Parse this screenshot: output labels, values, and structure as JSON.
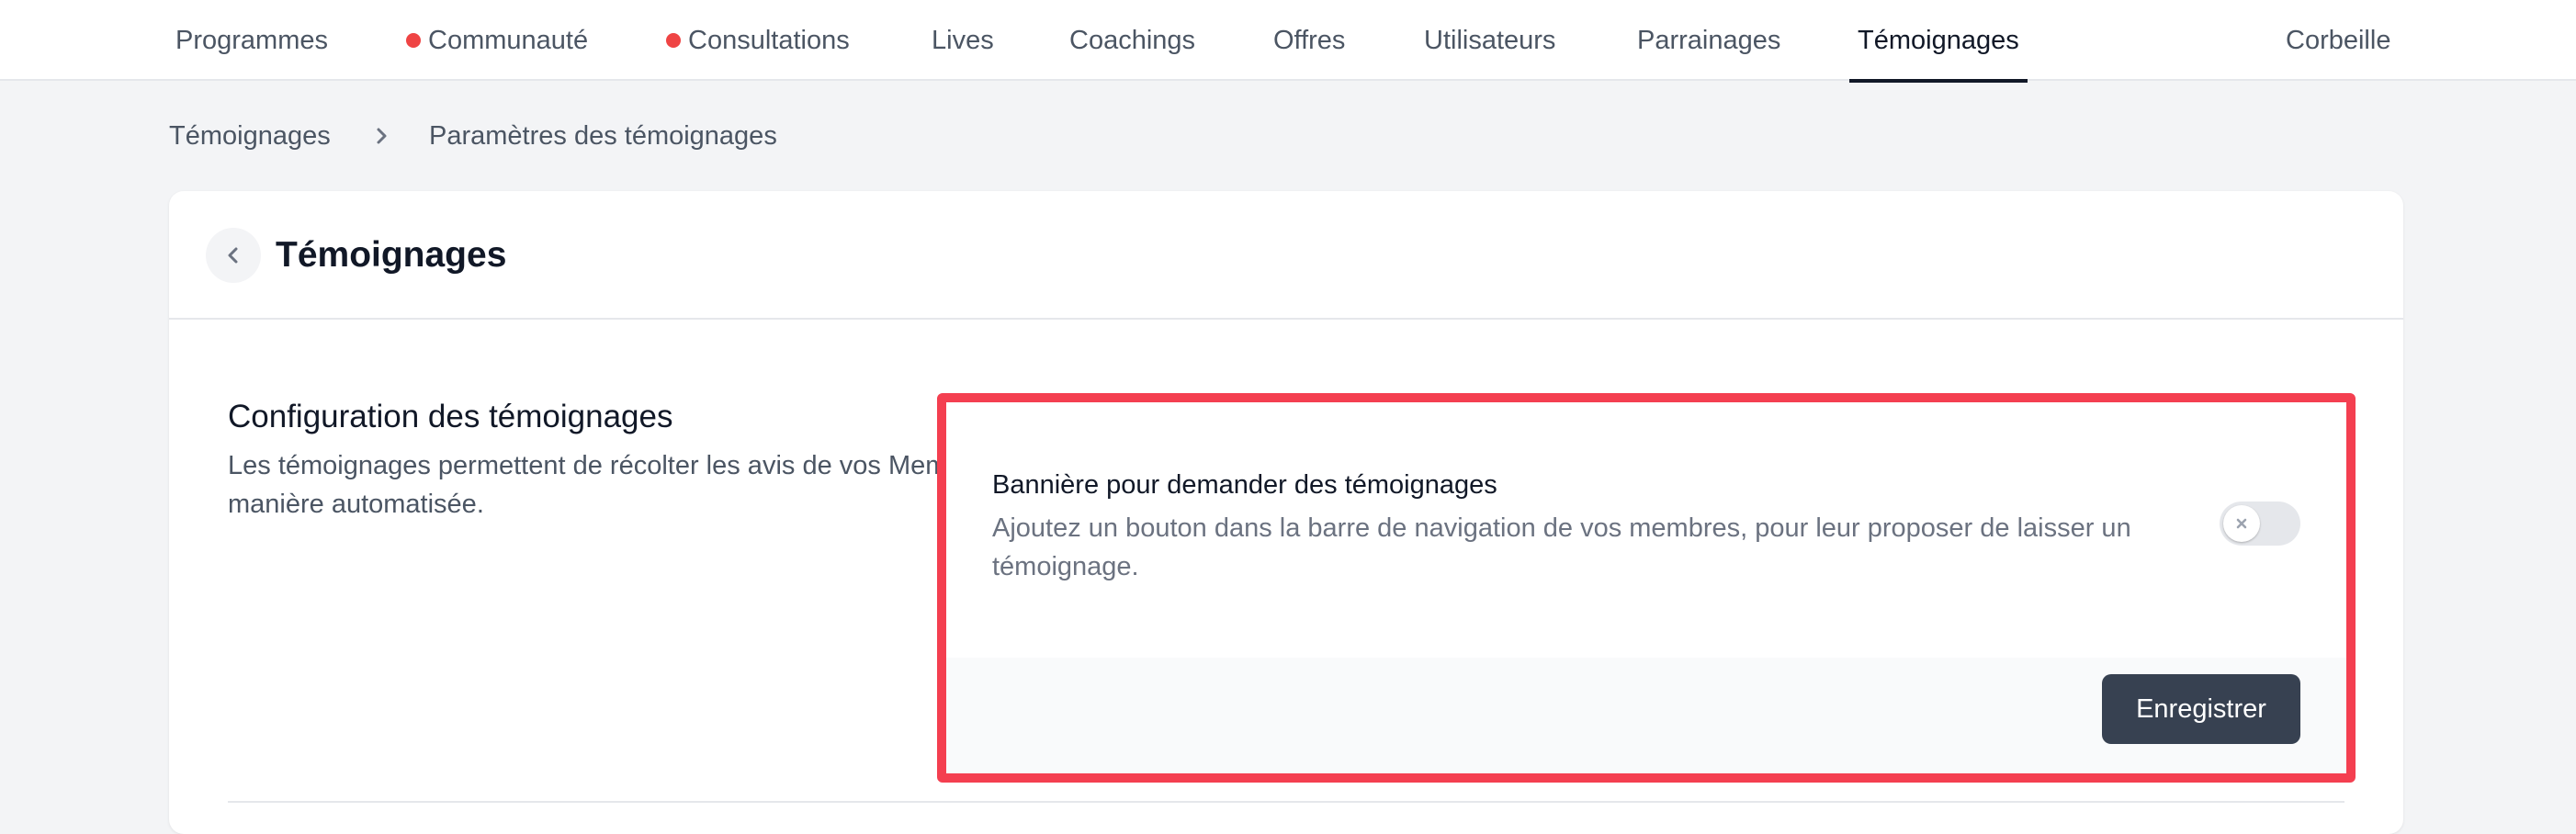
{
  "nav": {
    "items": [
      {
        "label": "Programmes",
        "dot": false
      },
      {
        "label": "Communauté",
        "dot": true
      },
      {
        "label": "Consultations",
        "dot": true
      },
      {
        "label": "Lives",
        "dot": false
      },
      {
        "label": "Coachings",
        "dot": false
      },
      {
        "label": "Offres",
        "dot": false
      },
      {
        "label": "Utilisateurs",
        "dot": false
      },
      {
        "label": "Parrainages",
        "dot": false
      },
      {
        "label": "Témoignages",
        "dot": false,
        "active": true
      },
      {
        "label": "Corbeille",
        "dot": false
      }
    ],
    "dot_color": "#ef4444"
  },
  "breadcrumb": {
    "items": [
      "Témoignages",
      "Paramètres des témoignages"
    ],
    "separator_icon": "chevron-right-icon"
  },
  "card": {
    "back_icon": "chevron-left-icon",
    "title": "Témoignages",
    "section_title": "Configuration des témoignages",
    "section_description": "Les témoignages permettent de récolter les avis de vos Membres de manière automatisée."
  },
  "setting": {
    "label": "Bannière pour demander des témoignages",
    "description": "Ajoutez un bouton dans la barre de navigation de vos membres, pour leur proposer de laisser un témoignage.",
    "enabled": false,
    "toggle_icon": "x-icon"
  },
  "actions": {
    "save_label": "Enregistrer"
  },
  "colors": {
    "highlight": "#f43f50",
    "primary_button": "#374151"
  }
}
